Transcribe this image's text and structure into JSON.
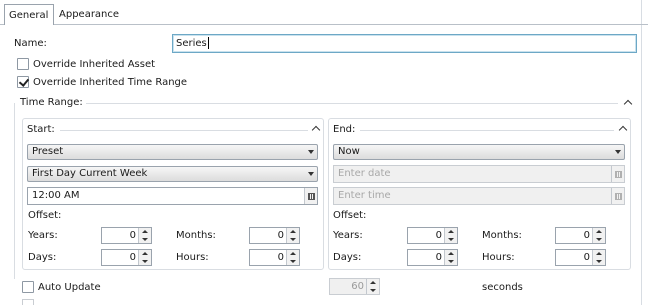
{
  "tabs": [
    {
      "label": "General"
    },
    {
      "label": "Appearance"
    }
  ],
  "name": {
    "label": "Name:",
    "value": "Series"
  },
  "override_asset": {
    "label": "Override Inherited Asset",
    "checked": false
  },
  "override_time_range": {
    "label": "Override Inherited Time Range",
    "checked": true
  },
  "time_range": {
    "label": "Time Range:",
    "start": {
      "label": "Start:",
      "mode": "Preset",
      "preset": "First Day Current Week",
      "time": "12:00 AM",
      "offset_label": "Offset:",
      "years": {
        "label": "Years:",
        "value": "0"
      },
      "months": {
        "label": "Months:",
        "value": "0"
      },
      "days": {
        "label": "Days:",
        "value": "0"
      },
      "hours": {
        "label": "Hours:",
        "value": "0"
      }
    },
    "end": {
      "label": "End:",
      "mode": "Now",
      "date_placeholder": "Enter date",
      "time_placeholder": "Enter time",
      "offset_label": "Offset:",
      "years": {
        "label": "Years:",
        "value": "0"
      },
      "months": {
        "label": "Months:",
        "value": "0"
      },
      "days": {
        "label": "Days:",
        "value": "0"
      },
      "hours": {
        "label": "Hours:",
        "value": "0"
      }
    }
  },
  "auto_update": {
    "label": "Auto Update",
    "checked": false,
    "interval": "60",
    "unit": "seconds"
  }
}
